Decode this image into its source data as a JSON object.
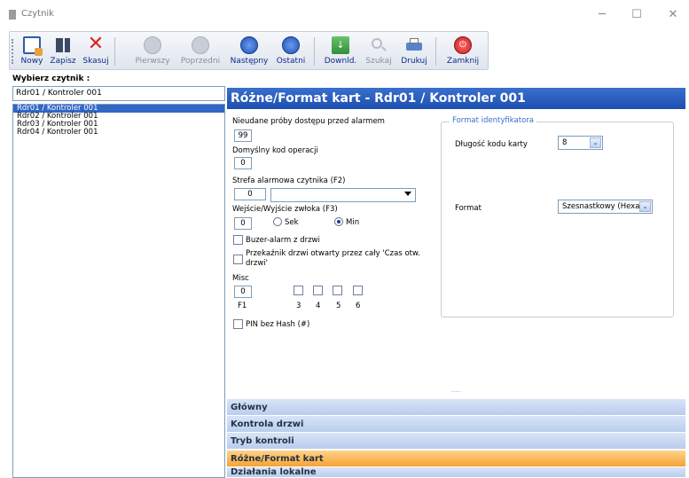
{
  "app": {
    "title": "Czytnik"
  },
  "toolbar": {
    "new": "Nowy",
    "save": "Zapisz",
    "delete": "Skasuj",
    "first": "Pierwszy",
    "prev": "Poprzedni",
    "next": "Następny",
    "last": "Ostatni",
    "download": "Downld.",
    "search": "Szukaj",
    "print": "Drukuj",
    "close": "Zamknij"
  },
  "left": {
    "label": "Wybierz czytnik :",
    "input_value": "Rdr01 / Kontroler 001",
    "items": [
      "Rdr01 / Kontroler 001",
      "Rdr02 / Kontroler 001",
      "Rdr03 / Kontroler 001",
      "Rdr04 / Kontroler 001"
    ]
  },
  "panel": {
    "title": "Różne/Format kart - Rdr01 / Kontroler 001",
    "failed_label": "Nieudane próby dostępu przed alarmem",
    "failed_value": "99",
    "opcode_label": "Domyślny kod operacji",
    "opcode_value": "0",
    "zone_label": "Strefa alarmowa czytnika (F2)",
    "zone_value": "0",
    "io_label": "Wejście/Wyjście  zwłoka (F3)",
    "io_value": "0",
    "io_sec": "Sek",
    "io_min": "Min",
    "buzzer_label": "Buzer-alarm z drzwi",
    "relay_label1": "Przekaźnik drzwi otwarty przez cały 'Czas otw.",
    "relay_label2": "drzwi'",
    "misc_label": "Misc",
    "misc_value": "0",
    "misc_f1": "F1",
    "misc_3": "3",
    "misc_4": "4",
    "misc_5": "5",
    "misc_6": "6",
    "pin_label": "PIN bez Hash (#)"
  },
  "format": {
    "group_label": "Format identyfikatora",
    "length_label": "Długość kodu karty",
    "length_value": "8",
    "format_label": "Format",
    "format_value": "Szesnastkowy (Hexa"
  },
  "accordion": {
    "main": "Główny",
    "door": "Kontrola drzwi",
    "mode": "Tryb kontroli",
    "misc": "Różne/Format kart",
    "local": "Działania lokalne"
  },
  "colors": {
    "header": "#2a5cbf",
    "selected": "#3167c5",
    "accent": "#f6a233"
  }
}
